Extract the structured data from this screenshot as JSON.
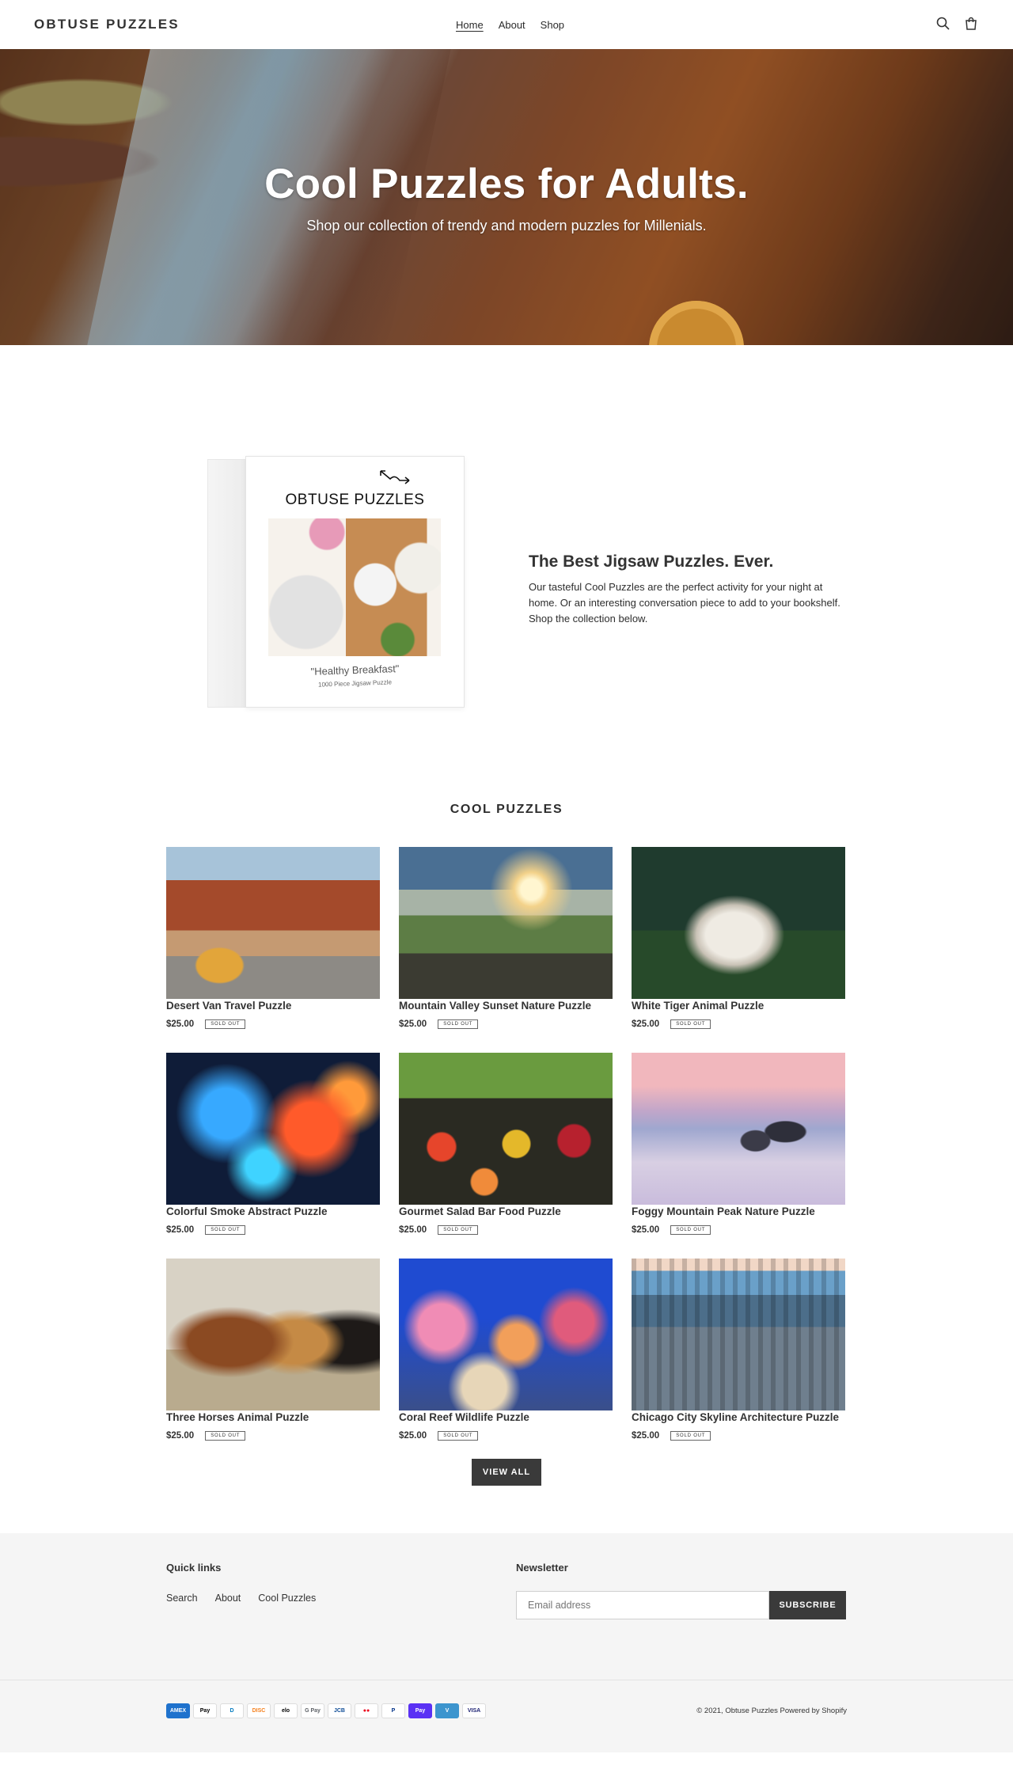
{
  "header": {
    "logo": "OBTUSE PUZZLES",
    "nav": [
      {
        "label": "Home",
        "active": true
      },
      {
        "label": "About",
        "active": false
      },
      {
        "label": "Shop",
        "active": false
      }
    ],
    "icons": [
      "search-icon",
      "cart-icon"
    ]
  },
  "hero": {
    "title": "Cool Puzzles for Adults.",
    "subtitle": "Shop our collection of trendy and modern puzzles for Millenials."
  },
  "intro": {
    "box_brand": "OBTUSE PUZZLES",
    "box_caption": "\"Healthy Breakfast\"",
    "box_subcaption": "1000 Piece Jigsaw Puzzle",
    "title": "The Best Jigsaw Puzzles. Ever.",
    "body": "Our tasteful Cool Puzzles are the perfect activity for your night at home. Or an interesting conversation piece to add to your bookshelf. Shop the collection below."
  },
  "collection": {
    "title": "COOL PUZZLES",
    "products": [
      {
        "title": "Desert Van Travel Puzzle",
        "price": "$25.00",
        "badge": "SOLD OUT"
      },
      {
        "title": "Mountain Valley Sunset Nature Puzzle",
        "price": "$25.00",
        "badge": "SOLD OUT"
      },
      {
        "title": "White Tiger Animal Puzzle",
        "price": "$25.00",
        "badge": "SOLD OUT"
      },
      {
        "title": "Colorful Smoke Abstract Puzzle",
        "price": "$25.00",
        "badge": "SOLD OUT"
      },
      {
        "title": "Gourmet Salad Bar Food Puzzle",
        "price": "$25.00",
        "badge": "SOLD OUT"
      },
      {
        "title": "Foggy Mountain Peak Nature Puzzle",
        "price": "$25.00",
        "badge": "SOLD OUT"
      },
      {
        "title": "Three Horses Animal Puzzle",
        "price": "$25.00",
        "badge": "SOLD OUT"
      },
      {
        "title": "Coral Reef Wildlife Puzzle",
        "price": "$25.00",
        "badge": "SOLD OUT"
      },
      {
        "title": "Chicago City Skyline Architecture Puzzle",
        "price": "$25.00",
        "badge": "SOLD OUT"
      }
    ],
    "view_all": "VIEW ALL"
  },
  "footer": {
    "quick_links_heading": "Quick links",
    "quick_links": [
      "Search",
      "About",
      "Cool Puzzles"
    ],
    "newsletter_heading": "Newsletter",
    "email_placeholder": "Email address",
    "subscribe": "SUBSCRIBE",
    "payment_icons": [
      {
        "name": "amex-icon",
        "label": "AMEX",
        "color": "#1f72cd"
      },
      {
        "name": "apple-pay-icon",
        "label": "Pay",
        "color": "#000000"
      },
      {
        "name": "diners-club-icon",
        "label": "D",
        "color": "#0079be"
      },
      {
        "name": "discover-icon",
        "label": "DISC",
        "color": "#f58220"
      },
      {
        "name": "elo-icon",
        "label": "elo",
        "color": "#000000"
      },
      {
        "name": "google-pay-icon",
        "label": "G Pay",
        "color": "#5f6368"
      },
      {
        "name": "jcb-icon",
        "label": "JCB",
        "color": "#0e4c96"
      },
      {
        "name": "mastercard-icon",
        "label": "●●",
        "color": "#eb001b"
      },
      {
        "name": "paypal-icon",
        "label": "P",
        "color": "#003087"
      },
      {
        "name": "shop-pay-icon",
        "label": "Pay",
        "color": "#5a31f4"
      },
      {
        "name": "venmo-icon",
        "label": "V",
        "color": "#3d95ce"
      },
      {
        "name": "visa-icon",
        "label": "VISA",
        "color": "#1a1f71"
      }
    ],
    "copyright": "© 2021, Obtuse Puzzles Powered by Shopify"
  }
}
